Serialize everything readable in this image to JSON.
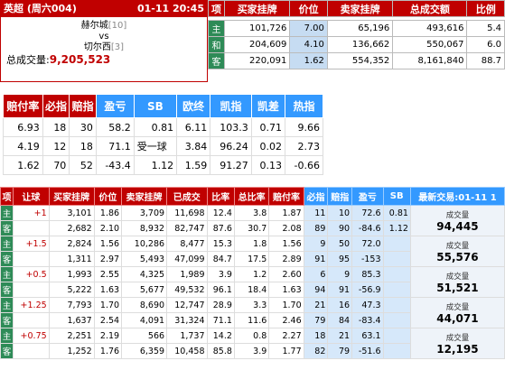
{
  "match": {
    "league": "英超 (周六004)",
    "time": "01-11 20:45",
    "home": "赫尔城",
    "home_rank": "[10]",
    "vs": "vs",
    "away": "切尔西",
    "away_rank": "[3]",
    "total_label": "总成交量:",
    "total_value": "9,205,523"
  },
  "odds_table": {
    "headers": [
      "项",
      "买家挂牌",
      "价位",
      "卖家挂牌",
      "总成交额",
      "比例"
    ],
    "rows": [
      {
        "label": "主",
        "buy": "101,726",
        "price": "7.00",
        "sell": "65,196",
        "total": "493,616",
        "ratio": "5.4"
      },
      {
        "label": "和",
        "buy": "204,609",
        "price": "4.10",
        "sell": "136,662",
        "total": "550,067",
        "ratio": "6.0"
      },
      {
        "label": "客",
        "buy": "220,091",
        "price": "1.62",
        "sell": "554,352",
        "total": "8,161,840",
        "ratio": "88.7"
      }
    ]
  },
  "index_table": {
    "headers": [
      "赔付率",
      "必指",
      "赔指",
      "盈亏",
      "SB",
      "欧终",
      "凯指",
      "凯差",
      "热指"
    ],
    "rows": [
      [
        "6.93",
        "18",
        "30",
        "58.2",
        "0.81",
        "6.11",
        "103.3",
        "0.71",
        "9.66"
      ],
      [
        "4.19",
        "12",
        "18",
        "71.1",
        "受一球",
        "3.84",
        "96.24",
        "0.02",
        "2.73"
      ],
      [
        "1.62",
        "70",
        "52",
        "-43.4",
        "1.12",
        "1.59",
        "91.27",
        "0.13",
        "-0.66"
      ]
    ]
  },
  "handicap_table": {
    "headers": [
      "项",
      "让球",
      "买家挂牌",
      "价位",
      "卖家挂牌",
      "已成交",
      "比率",
      "总比率",
      "赔付率",
      "必指",
      "赔指",
      "盈亏",
      "SB",
      "最新交易:01-11 1"
    ],
    "vol_label": "成交量",
    "groups": [
      {
        "handicap": "+1",
        "volume": "94,445",
        "rows": [
          {
            "label": "主",
            "buy": "3,101",
            "price": "1.86",
            "sell": "3,709",
            "done": "11,698",
            "rate": "12.4",
            "total_rate": "3.8",
            "pay": "1.87",
            "bi": "11",
            "pei": "10",
            "pnl": "72.6",
            "sb": "0.81"
          },
          {
            "label": "客",
            "buy": "2,682",
            "price": "2.10",
            "sell": "8,932",
            "done": "82,747",
            "rate": "87.6",
            "total_rate": "30.7",
            "pay": "2.08",
            "bi": "89",
            "pei": "90",
            "pnl": "-84.6",
            "sb": "1.12"
          }
        ]
      },
      {
        "handicap": "+1.5",
        "volume": "55,576",
        "rows": [
          {
            "label": "主",
            "buy": "2,824",
            "price": "1.56",
            "sell": "10,286",
            "done": "8,477",
            "rate": "15.3",
            "total_rate": "1.8",
            "pay": "1.56",
            "bi": "9",
            "pei": "50",
            "pnl": "72.0",
            "sb": ""
          },
          {
            "label": "客",
            "buy": "1,311",
            "price": "2.97",
            "sell": "5,493",
            "done": "47,099",
            "rate": "84.7",
            "total_rate": "17.5",
            "pay": "2.89",
            "bi": "91",
            "pei": "95",
            "pnl": "-153",
            "sb": ""
          }
        ]
      },
      {
        "handicap": "+0.5",
        "volume": "51,521",
        "rows": [
          {
            "label": "主",
            "buy": "1,993",
            "price": "2.55",
            "sell": "4,325",
            "done": "1,989",
            "rate": "3.9",
            "total_rate": "1.2",
            "pay": "2.60",
            "bi": "6",
            "pei": "9",
            "pnl": "85.3",
            "sb": ""
          },
          {
            "label": "客",
            "buy": "5,222",
            "price": "1.63",
            "sell": "5,677",
            "done": "49,532",
            "rate": "96.1",
            "total_rate": "18.4",
            "pay": "1.63",
            "bi": "94",
            "pei": "91",
            "pnl": "-56.9",
            "sb": ""
          }
        ]
      },
      {
        "handicap": "+1.25",
        "volume": "44,071",
        "rows": [
          {
            "label": "主",
            "buy": "7,793",
            "price": "1.70",
            "sell": "8,690",
            "done": "12,747",
            "rate": "28.9",
            "total_rate": "3.3",
            "pay": "1.70",
            "bi": "21",
            "pei": "16",
            "pnl": "47.3",
            "sb": ""
          },
          {
            "label": "客",
            "buy": "1,637",
            "price": "2.54",
            "sell": "4,091",
            "done": "31,324",
            "rate": "71.1",
            "total_rate": "11.6",
            "pay": "2.46",
            "bi": "79",
            "pei": "84",
            "pnl": "-83.4",
            "sb": ""
          }
        ]
      },
      {
        "handicap": "+0.75",
        "volume": "12,195",
        "rows": [
          {
            "label": "主",
            "buy": "2,251",
            "price": "2.19",
            "sell": "566",
            "done": "1,737",
            "rate": "14.2",
            "total_rate": "0.8",
            "pay": "2.27",
            "bi": "18",
            "pei": "21",
            "pnl": "63.1",
            "sb": ""
          },
          {
            "label": "客",
            "buy": "1,252",
            "price": "1.76",
            "sell": "6,359",
            "done": "10,458",
            "rate": "85.8",
            "total_rate": "3.9",
            "pay": "1.77",
            "bi": "82",
            "pei": "79",
            "pnl": "-51.6",
            "sb": ""
          }
        ]
      }
    ]
  }
}
